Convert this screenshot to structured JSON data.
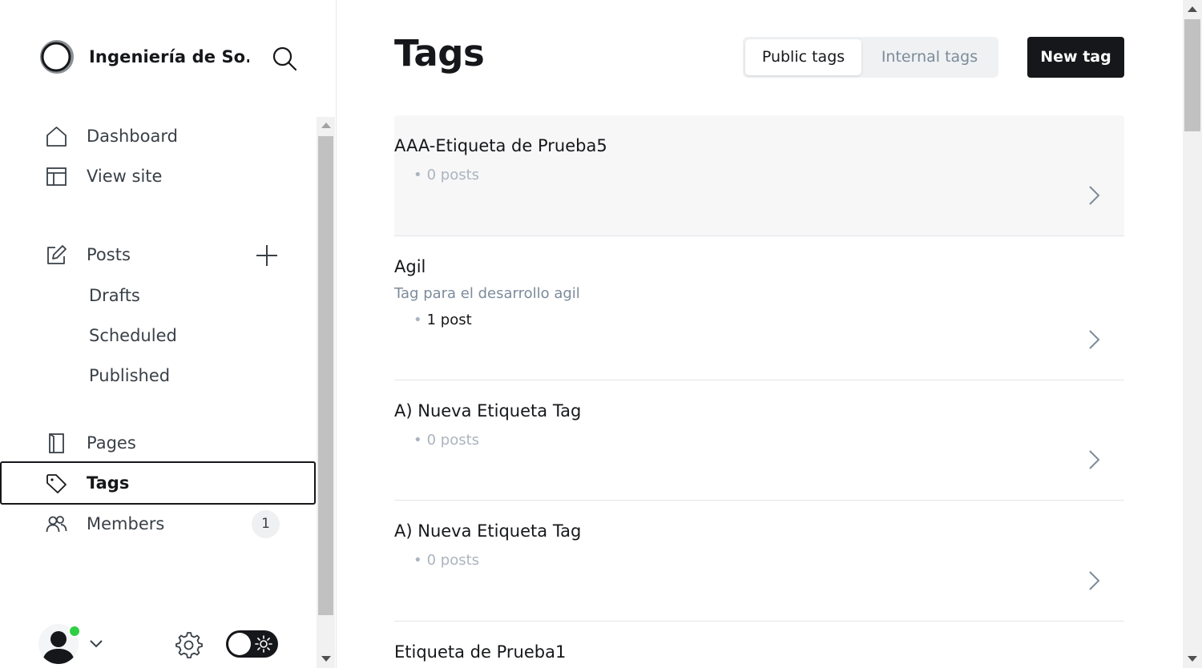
{
  "sidebar": {
    "site_name": "Ingeniería de So...",
    "search_icon": "search-icon",
    "nav": {
      "dashboard": "Dashboard",
      "view_site": "View site",
      "posts": "Posts",
      "drafts": "Drafts",
      "scheduled": "Scheduled",
      "published": "Published",
      "pages": "Pages",
      "tags": "Tags",
      "members": "Members",
      "members_count": "1"
    },
    "active_item": "tags"
  },
  "main": {
    "title": "Tags",
    "filter": {
      "public_label": "Public tags",
      "internal_label": "Internal tags",
      "selected": "public"
    },
    "new_tag_label": "New tag",
    "tags": [
      {
        "name": "AAA-Etiqueta de Prueba5",
        "description": "",
        "count": "0 posts"
      },
      {
        "name": "Agil",
        "description": "Tag para el desarrollo agil",
        "count": "1 post"
      },
      {
        "name": "A) Nueva Etiqueta Tag",
        "description": "",
        "count": "0 posts"
      },
      {
        "name": "A) Nueva Etiqueta Tag",
        "description": "",
        "count": "0 posts"
      },
      {
        "name": "Etiqueta de Prueba1",
        "description": "",
        "count": ""
      }
    ]
  },
  "colors": {
    "accent_dark": "#15171a",
    "online": "#30cf43",
    "muted_text": "#7c8b9a"
  }
}
